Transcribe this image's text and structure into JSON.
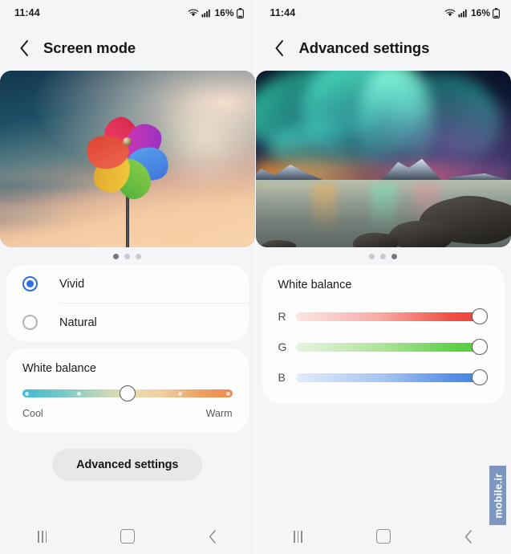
{
  "statusbar": {
    "time": "11:44",
    "battery_percent": "16%",
    "wifi_icon": "wifi-icon",
    "signal_icon": "signal-bars-icon",
    "battery_icon": "battery-icon"
  },
  "left": {
    "title": "Screen mode",
    "back_icon": "back-chevron-icon",
    "preview": {
      "name": "pinwheel-sunset-preview",
      "dots": [
        true,
        false,
        false
      ]
    },
    "modes": [
      {
        "label": "Vivid",
        "selected": true
      },
      {
        "label": "Natural",
        "selected": false
      }
    ],
    "white_balance": {
      "title": "White balance",
      "cool_label": "Cool",
      "warm_label": "Warm",
      "thumb_percent": 50,
      "tick_percents": [
        2,
        27,
        52,
        75,
        98
      ],
      "gradient_from": "#3fb9d4",
      "gradient_to": "#ee8b4e"
    },
    "advanced_button": "Advanced settings"
  },
  "right": {
    "title": "Advanced settings",
    "back_icon": "back-chevron-icon",
    "preview": {
      "name": "aurora-borealis-preview",
      "dots": [
        false,
        false,
        true
      ]
    },
    "white_balance": {
      "title": "White balance",
      "channels": [
        {
          "label": "R",
          "value_percent": 100,
          "color": "#ee3b2e"
        },
        {
          "label": "G",
          "value_percent": 100,
          "color": "#4ecb38"
        },
        {
          "label": "B",
          "value_percent": 100,
          "color": "#3f7ddf"
        }
      ]
    }
  },
  "navbar": {
    "recents_label": "recents-icon",
    "home_label": "home-icon",
    "back_label": "back-icon"
  },
  "watermark": {
    "text": "mobile.ir"
  }
}
